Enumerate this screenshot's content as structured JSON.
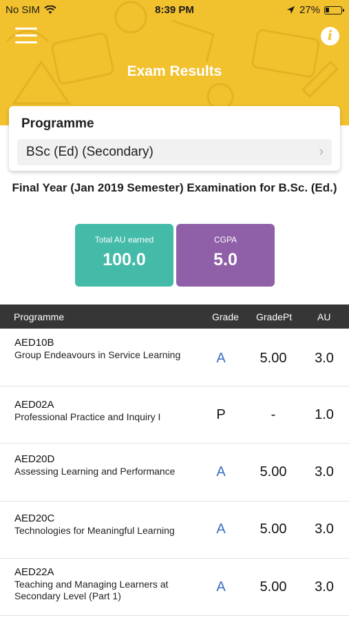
{
  "status_bar": {
    "carrier": "No SIM",
    "time": "8:39 PM",
    "battery_text": "27%",
    "battery_level": 0.27
  },
  "header": {
    "title": "Exam Results",
    "menu_icon": "hamburger-menu-icon",
    "info_icon": "info-icon",
    "color": "#f2c12e"
  },
  "programme_card": {
    "label": "Programme",
    "selected_value": "BSc (Ed) (Secondary)"
  },
  "exam_title": "Final Year (Jan 2019 Semester) Examination for B.Sc. (Ed.)",
  "stats": {
    "au_label": "Total AU earned",
    "au_value": "100.0",
    "au_color": "#44bba9",
    "cgpa_label": "CGPA",
    "cgpa_value": "5.0",
    "cgpa_color": "#8f5fa8"
  },
  "table": {
    "headers": [
      "Programme",
      "Grade",
      "GradePt",
      "AU"
    ],
    "rows": [
      {
        "code": "AED10B",
        "name": "Group Endeavours in Service Learning",
        "grade": "A",
        "grade_point": "5.00",
        "au": "3.0"
      },
      {
        "code": "AED02A",
        "name": "Professional Practice and Inquiry I",
        "grade": "P",
        "grade_point": "-",
        "au": "1.0"
      },
      {
        "code": "AED20D",
        "name": "Assessing Learning and Performance",
        "grade": "A",
        "grade_point": "5.00",
        "au": "3.0"
      },
      {
        "code": "AED20C",
        "name": "Technologies for Meaningful Learning",
        "grade": "A",
        "grade_point": "5.00",
        "au": "3.0"
      },
      {
        "code": "AED22A",
        "name": "Teaching and Managing Learners at Secondary Level (Part 1)",
        "grade": "A",
        "grade_point": "5.00",
        "au": "3.0"
      }
    ],
    "grade_a_color": "#3a6fc4",
    "grade_other_color": "#111111"
  }
}
